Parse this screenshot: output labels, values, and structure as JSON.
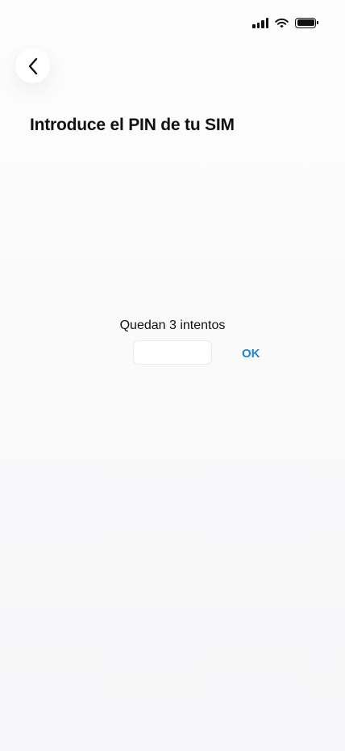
{
  "header": {
    "title": "Introduce el PIN de tu SIM"
  },
  "pin_entry": {
    "attempts_text": "Quedan 3 intentos",
    "value": "",
    "ok_label": "OK"
  },
  "colors": {
    "accent": "#1a86d8",
    "text": "#111111",
    "background": "#f9f9fb"
  },
  "icons": {
    "back": "chevron-left-icon",
    "signal": "cellular-signal-icon",
    "wifi": "wifi-icon",
    "battery": "battery-icon"
  }
}
